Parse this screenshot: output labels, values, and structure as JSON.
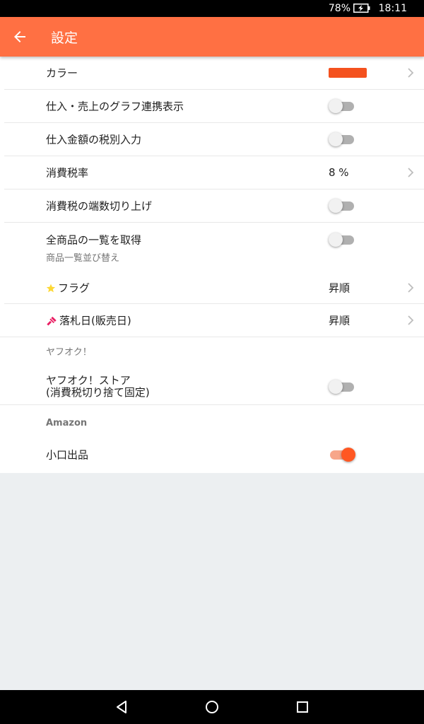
{
  "status_bar": {
    "battery": "78%",
    "time": "18:11"
  },
  "app_bar": {
    "title": "設定"
  },
  "colors": {
    "accent": "#ff7043",
    "swatch": "#f4511e",
    "toggle_on": "#ff5722"
  },
  "settings": {
    "color": {
      "label": "カラー"
    },
    "graph_link": {
      "label": "仕入・売上のグラフ連携表示",
      "on": false
    },
    "tax_excluded": {
      "label": "仕入金額の税別入力",
      "on": false
    },
    "tax_rate": {
      "label": "消費税率",
      "value": "8 %"
    },
    "tax_roundup": {
      "label": "消費税の端数切り上げ",
      "on": false
    },
    "all_products": {
      "label": "全商品の一覧を取得",
      "on": false
    }
  },
  "sort_section": {
    "header": "商品一覧並び替え",
    "flag": {
      "label": "フラグ",
      "value": "昇順",
      "icon": "star-icon"
    },
    "auction_date": {
      "label": "落札日(販売日)",
      "value": "昇順",
      "icon": "gavel-icon"
    }
  },
  "yahoo_section": {
    "header": "ヤフオク！",
    "store": {
      "label_line1": "ヤフオク！ストア",
      "label_line2": "(消費税切り捨て固定)",
      "on": false
    }
  },
  "amazon_section": {
    "header": "Amazon",
    "small_lot": {
      "label": "小口出品",
      "on": true
    }
  }
}
